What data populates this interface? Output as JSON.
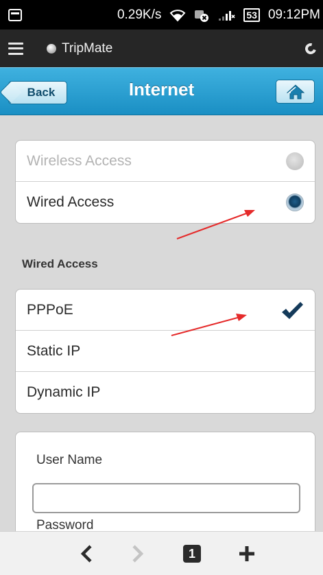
{
  "status_bar": {
    "speed": "0.29K/s",
    "battery": "53",
    "time": "09:12PM"
  },
  "browser": {
    "site_title": "TripMate",
    "tab_count": "1"
  },
  "header": {
    "back_label": "Back",
    "title": "Internet"
  },
  "access_modes": [
    {
      "label": "Wireless Access",
      "selected": false,
      "enabled": false
    },
    {
      "label": "Wired Access",
      "selected": true,
      "enabled": true
    }
  ],
  "wired_section": {
    "heading": "Wired Access",
    "options": [
      {
        "label": "PPPoE",
        "checked": true
      },
      {
        "label": "Static IP",
        "checked": false
      },
      {
        "label": "Dynamic IP",
        "checked": false
      }
    ]
  },
  "pppoe_form": {
    "username_label": "User Name",
    "username_value": "",
    "password_label": "Password"
  },
  "colors": {
    "header_blue": "#1a8fc4",
    "check_navy": "#143a5a",
    "annotation_red": "#e52a2a"
  }
}
